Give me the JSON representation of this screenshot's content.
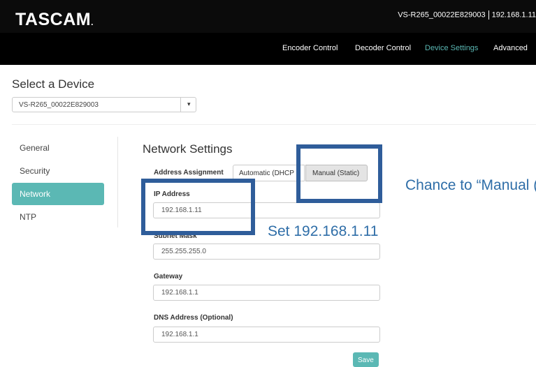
{
  "header": {
    "brand": "TASCAM",
    "brand_mark": ".",
    "device_name": "VS-R265_00022E829003",
    "ip_display": "192.168.1.11"
  },
  "nav": {
    "items": [
      {
        "label": "Encoder Control",
        "active": false
      },
      {
        "label": "Decoder Control",
        "active": false
      },
      {
        "label": "Device Settings",
        "active": true
      },
      {
        "label": "Advanced",
        "active": false
      }
    ]
  },
  "device_select": {
    "title": "Select a Device",
    "selected": "VS-R265_00022E829003",
    "caret": "▾"
  },
  "sidebar": {
    "items": [
      {
        "label": "General",
        "active": false
      },
      {
        "label": "Security",
        "active": false
      },
      {
        "label": "Network",
        "active": true
      },
      {
        "label": "NTP",
        "active": false
      }
    ]
  },
  "network": {
    "title": "Network Settings",
    "address_assignment_label": "Address Assignment",
    "automatic_label": "Automatic (DHCP",
    "manual_label": "Manual (Static)",
    "ip_label": "IP Address",
    "ip_value": "192.168.1.11",
    "subnet_label": "Subnet Mask",
    "subnet_value": "255.255.255.0",
    "gateway_label": "Gateway",
    "gateway_value": "192.168.1.1",
    "dns_label": "DNS Address (Optional)",
    "dns_value": "192.168.1.1",
    "save_label": "Save"
  },
  "annotations": {
    "manual_note": "Chance to “Manual (Static)”",
    "ip_note": "Set 192.168.1.11"
  },
  "colors": {
    "accent": "#5bb8b4",
    "annotation": "#2f5d9a",
    "topbar": "#0b0b0b"
  }
}
